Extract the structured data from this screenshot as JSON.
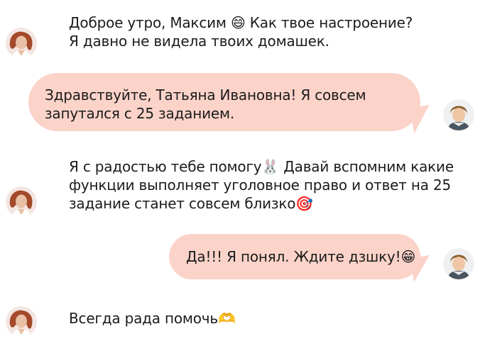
{
  "messages": [
    {
      "sender": "teacher",
      "lines": [
        "Доброе утро, Максим 😄 Как твое настроение?",
        "Я давно не видела твоих домашек."
      ]
    },
    {
      "sender": "student",
      "lines": [
        "Здравствуйте, Татьяна Ивановна! Я совсем",
        "запутался с 25 заданием."
      ]
    },
    {
      "sender": "teacher",
      "lines": [
        "Я с радостью тебе помогу🐰 Давай вспомним какие",
        "функции выполняет уголовное право и ответ на 25",
        "задание станет совсем близко🎯"
      ]
    },
    {
      "sender": "student",
      "lines": [
        "Да!!! Я понял. Ждите дзшку!😁"
      ]
    },
    {
      "sender": "teacher",
      "lines": [
        "Всегда рада помочь🫶"
      ]
    }
  ],
  "colors": {
    "bubble": "#fbd3c9",
    "text": "#1c1c1c"
  },
  "icons": {
    "teacher_avatar": "teacher-avatar",
    "student_avatar": "student-avatar"
  }
}
